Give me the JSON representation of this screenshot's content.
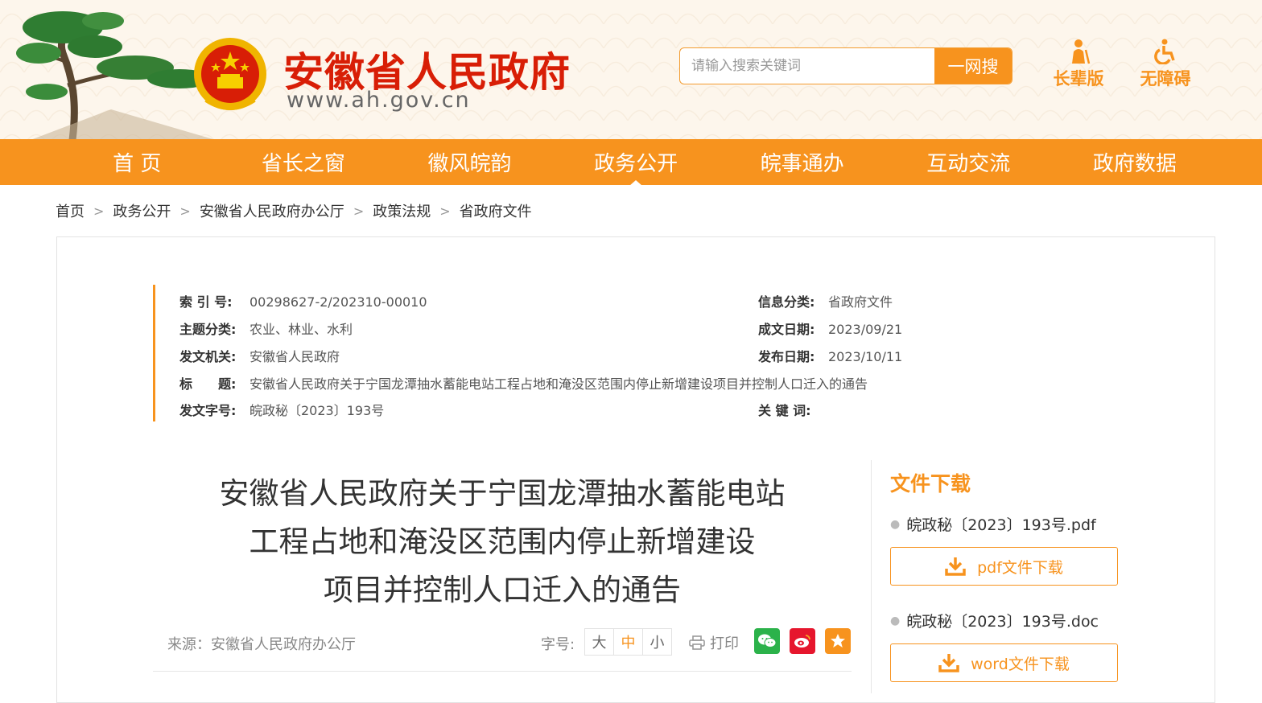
{
  "header": {
    "site_title": "安徽省人民政府",
    "site_url": "www.ah.gov.cn",
    "search": {
      "placeholder": "请输入搜索关键词",
      "button_label": "一网搜"
    },
    "quick_links": [
      {
        "label": "长辈版",
        "icon": "elder-icon"
      },
      {
        "label": "无障碍",
        "icon": "accessibility-icon"
      }
    ],
    "brand_color": "#f7931e",
    "title_color": "#d81e06"
  },
  "nav": {
    "items": [
      {
        "label": "首 页"
      },
      {
        "label": "省长之窗"
      },
      {
        "label": "徽风皖韵"
      },
      {
        "label": "政务公开",
        "active": true
      },
      {
        "label": "皖事通办"
      },
      {
        "label": "互动交流"
      },
      {
        "label": "政府数据"
      }
    ]
  },
  "breadcrumb": [
    "首页",
    "政务公开",
    "安徽省人民政府办公厅",
    "政策法规",
    "省政府文件"
  ],
  "meta": {
    "index_label": "索 引 号:",
    "index_value": "00298627-2/202310-00010",
    "topic_label": "主题分类:",
    "topic_value": "农业、林业、水利",
    "issuer_label": "发文机关:",
    "issuer_value": "安徽省人民政府",
    "title_label": "标　　题:",
    "title_value": "安徽省人民政府关于宁国龙潭抽水蓄能电站工程占地和淹没区范围内停止新增建设项目并控制人口迁入的通告",
    "docno_label": "发文字号:",
    "docno_value": "皖政秘〔2023〕193号",
    "category_label": "信息分类:",
    "category_value": "省政府文件",
    "created_label": "成文日期:",
    "created_value": "2023/09/21",
    "published_label": "发布日期:",
    "published_value": "2023/10/11",
    "keywords_label": "关 键 词:",
    "keywords_value": ""
  },
  "article": {
    "title_lines": [
      "安徽省人民政府关于宁国龙潭抽水蓄能电站",
      "工程占地和淹没区范围内停止新增建设",
      "项目并控制人口迁入的通告"
    ],
    "source": "来源：安徽省人民政府办公厅",
    "font_size_label": "字号:",
    "font_sizes": [
      "大",
      "中",
      "小"
    ],
    "font_size_selected": "中",
    "print_label": "打印",
    "share_icons": [
      "wechat-icon",
      "weibo-icon",
      "favorite-icon"
    ]
  },
  "downloads": {
    "title": "文件下载",
    "files": [
      {
        "name": "皖政秘〔2023〕193号.pdf",
        "button": "pdf文件下载"
      },
      {
        "name": "皖政秘〔2023〕193号.doc",
        "button": "word文件下载"
      }
    ]
  }
}
